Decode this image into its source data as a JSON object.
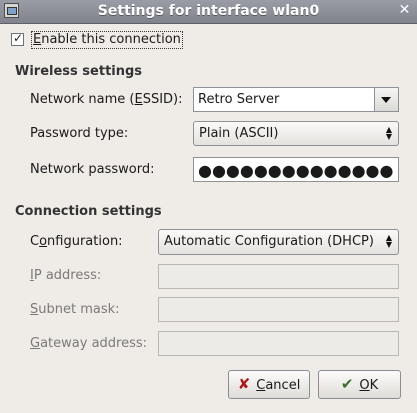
{
  "window": {
    "title": "Settings for interface wlan0",
    "close_glyph": "✕"
  },
  "enable": {
    "label_first": "E",
    "label_rest": "nable this connection",
    "checked": true
  },
  "wireless": {
    "section_title": "Wireless settings",
    "essid_label_pre": "Network name (",
    "essid_label_u": "E",
    "essid_label_post": "SSID):",
    "essid_value": "Retro Server",
    "password_type_label": "Password type:",
    "password_type_value": "Plain (ASCII)",
    "password_label": "Network password:",
    "password_mask": "●●●●●●●●●●●●●●"
  },
  "connection": {
    "section_title": "Connection settings",
    "config_label_pre": "C",
    "config_label_u": "o",
    "config_label_post": "nfiguration:",
    "config_value": "Automatic Configuration (DHCP)",
    "ip_label_u": "I",
    "ip_label_rest": "P address:",
    "subnet_label_u": "S",
    "subnet_label_rest": "ubnet mask:",
    "gateway_label_u": "G",
    "gateway_label_rest": "ateway address:"
  },
  "buttons": {
    "cancel_icon": "✘",
    "cancel_u": "C",
    "cancel_rest": "ancel",
    "ok_icon": "✔",
    "ok_u": "O",
    "ok_rest": "K"
  }
}
